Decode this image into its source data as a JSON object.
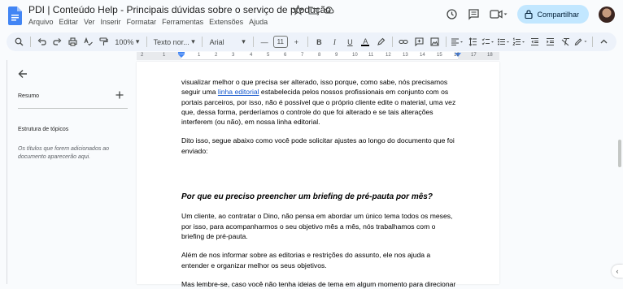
{
  "header": {
    "title": "PDI | Conteúdo Help - Principais dúvidas sobre o serviço de produção",
    "menu": [
      "Arquivo",
      "Editar",
      "Ver",
      "Inserir",
      "Formatar",
      "Ferramentas",
      "Extensões",
      "Ajuda"
    ],
    "share_label": "Compartilhar"
  },
  "toolbar": {
    "zoom": "100%",
    "style": "Texto nor...",
    "font": "Arial",
    "font_size": "11"
  },
  "ruler": {
    "numbers": [
      "2",
      "1",
      "1",
      "2",
      "3",
      "4",
      "5",
      "6",
      "7",
      "8",
      "9",
      "10",
      "11",
      "12",
      "13",
      "14",
      "15",
      "16",
      "17",
      "18"
    ]
  },
  "sidebar": {
    "resumo": "Resumo",
    "outline_title": "Estrutura de tópicos",
    "outline_hint": "Os títulos que forem adicionados ao documento aparecerão aqui."
  },
  "document": {
    "p1_before": "visualizar melhor o que precisa ser alterado, isso porque, como sabe, nós precisamos seguir uma ",
    "p1_link": "linha editorial",
    "p1_after": " estabelecida pelos nossos profissionais em conjunto com os portais parceiros, por isso, não é possível que o próprio cliente edite o material, uma vez que, dessa forma, perderíamos o controle do que foi alterado e se tais alterações interferem (ou não), em nossa linha editorial.",
    "p2": "Dito isso, segue abaixo como você pode solicitar ajustes ao longo do documento que foi enviado:",
    "heading": "Por que eu preciso preencher um briefing de pré-pauta por mês?",
    "p3": "Um cliente, ao contratar o Dino, não pensa em abordar um único tema todos os meses, por isso, para acompanharmos o seu objetivo mês a mês, nós trabalhamos com o briefing de pré-pauta.",
    "p4": "Além de nos informar sobre as editorias e restrições do assunto, ele nos ajuda a entender e organizar melhor os seus objetivos.",
    "p5": "Mas lembre-se, caso você não tenha ideias de tema em algum momento para direcionar"
  },
  "colors": {
    "share_bg": "#c2e7ff",
    "toolbar_bg": "#edf2fa",
    "link": "#1155cc",
    "docs_blue": "#4285f4"
  }
}
